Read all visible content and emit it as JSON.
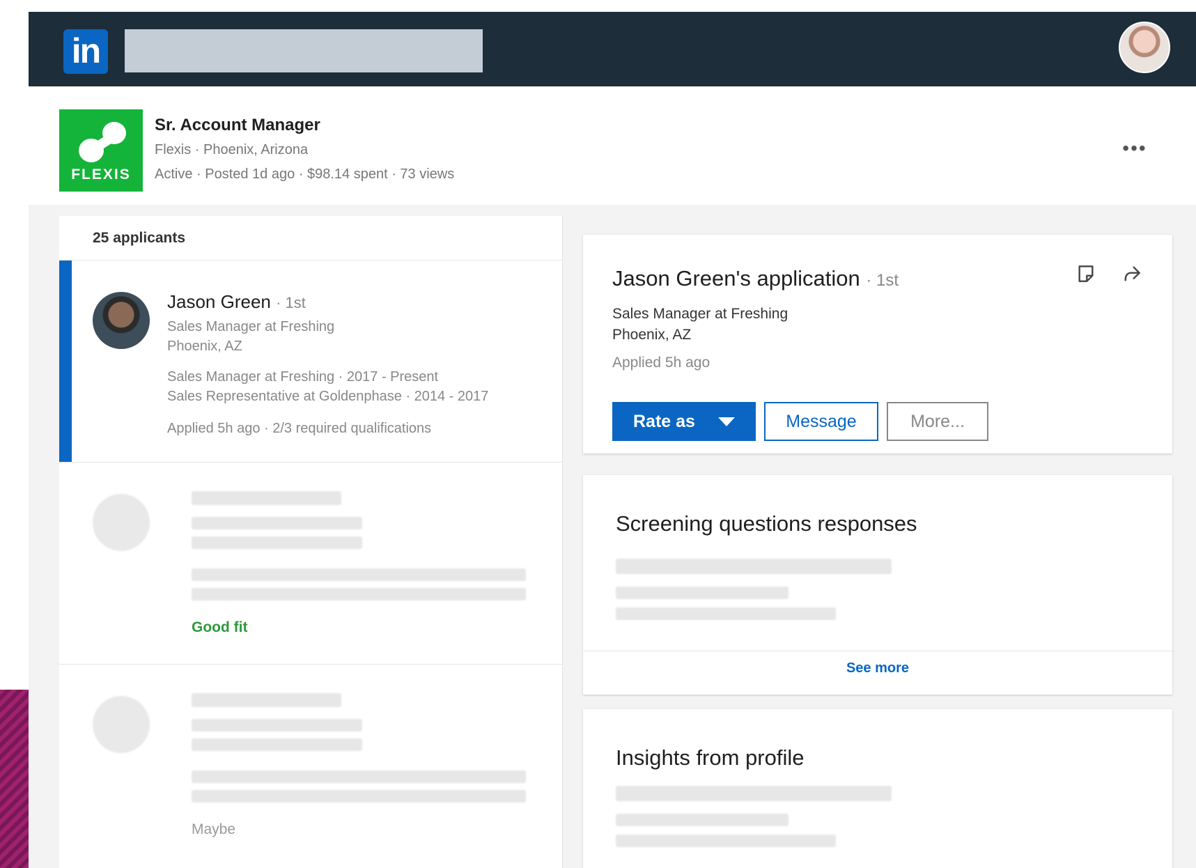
{
  "topbar": {
    "logo_text": "in",
    "search_placeholder": ""
  },
  "job": {
    "title": "Sr. Account Manager",
    "company_location": "Flexis · Phoenix, Arizona",
    "status_line": "Active · Posted 1d ago · $98.14 spent · 73 views",
    "company_logo_text": "FLEXIS",
    "more_label": "•••"
  },
  "applicants": {
    "count_label": "25 applicants",
    "selected": {
      "name": "Jason Green",
      "degree": "· 1st",
      "headline": "Sales Manager at Freshing",
      "location": "Phoenix, AZ",
      "experience": [
        "Sales Manager at Freshing · 2017 - Present",
        "Sales Representative at Goldenphase · 2014 - 2017"
      ],
      "applied_info": "Applied 5h ago · 2/3 required qualifications"
    },
    "others": [
      {
        "fit_label": "Good fit"
      },
      {
        "fit_label": "Maybe"
      }
    ]
  },
  "application_card": {
    "title": "Jason Green's application",
    "degree": "· 1st",
    "headline": "Sales Manager at Freshing",
    "location": "Phoenix, AZ",
    "applied": "Applied 5h ago",
    "rate_label": "Rate as",
    "message_label": "Message",
    "more_label": "More..."
  },
  "screening_card": {
    "heading": "Screening questions responses",
    "see_more_label": "See more"
  },
  "insights_card": {
    "heading": "Insights from profile"
  },
  "colors": {
    "nav_bg": "#1d2d3a",
    "brand_blue": "#0a66c2",
    "company_green": "#14b43a",
    "good_fit_green": "#2e9a3b"
  }
}
